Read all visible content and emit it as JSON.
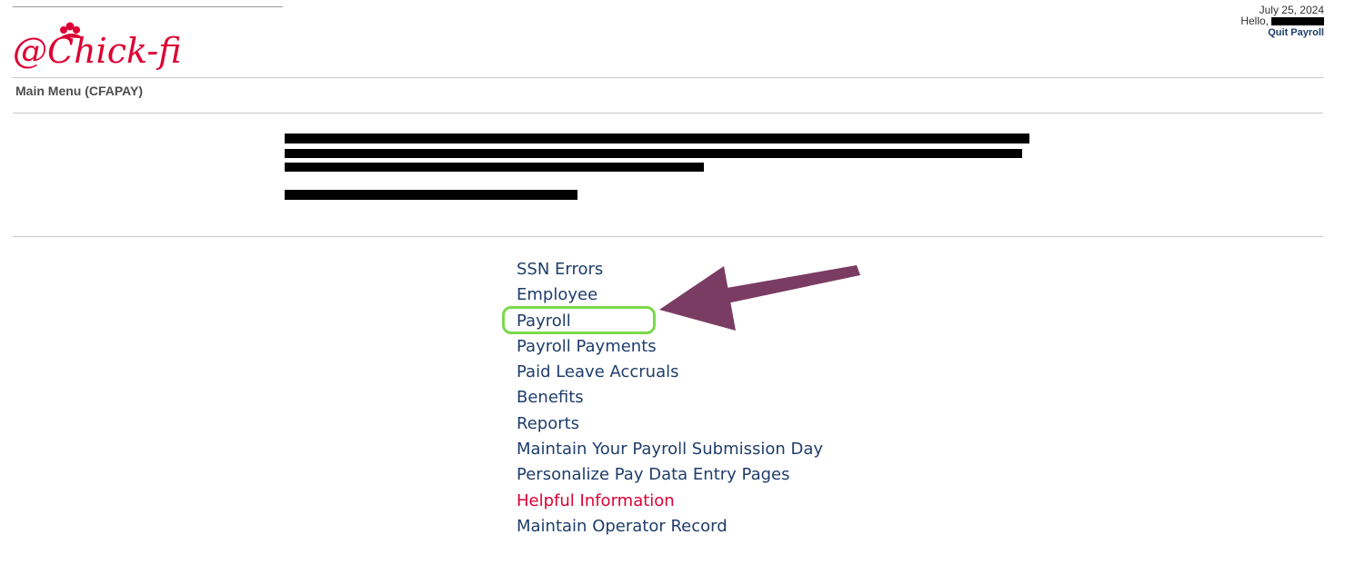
{
  "header": {
    "date": "July 25, 2024",
    "greeting": "Hello,",
    "quit_label": "Quit Payroll"
  },
  "logo": {
    "text": "@Chick-fil-A",
    "color": "#dd0033"
  },
  "page_title": "Main Menu (CFAPAY)",
  "menu": {
    "items": [
      {
        "label": "SSN Errors"
      },
      {
        "label": "Employee"
      },
      {
        "label": "Payroll",
        "highlighted": true
      },
      {
        "label": "Payroll Payments"
      },
      {
        "label": "Paid Leave Accruals"
      },
      {
        "label": "Benefits"
      },
      {
        "label": "Reports"
      },
      {
        "label": "Maintain Your Payroll Submission Day"
      },
      {
        "label": "Personalize Pay Data Entry Pages"
      },
      {
        "label": "Helpful Information",
        "color": "#dd0033"
      },
      {
        "label": "Maintain Operator Record"
      }
    ]
  },
  "annotation": {
    "ring_color": "#7bd94a",
    "arrow_color": "#7a3c63"
  },
  "colors": {
    "link": "#1f3d6b",
    "accent_red": "#dd0033"
  }
}
